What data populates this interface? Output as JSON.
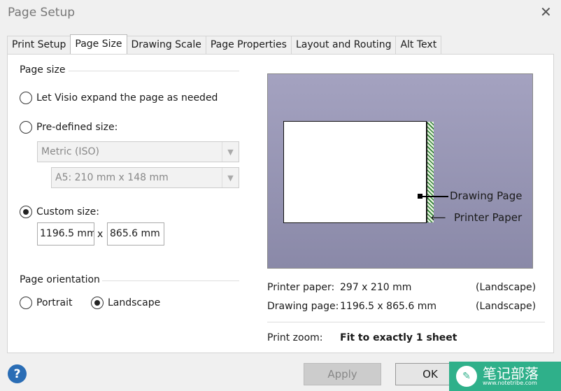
{
  "window": {
    "title": "Page Setup"
  },
  "tabs": [
    {
      "label": "Print Setup"
    },
    {
      "label": "Page Size"
    },
    {
      "label": "Drawing Scale"
    },
    {
      "label": "Page Properties"
    },
    {
      "label": "Layout and Routing"
    },
    {
      "label": "Alt Text"
    }
  ],
  "active_tab": "Page Size",
  "page_size": {
    "heading": "Page size",
    "option_expand": "Let Visio expand the page as needed",
    "option_predefined": "Pre-defined size:",
    "predefined_category": "Metric (ISO)",
    "predefined_size": "A5:  210 mm x 148 mm",
    "option_custom": "Custom size:",
    "selected": "custom",
    "custom_width": "1196.5 mm",
    "times": "x",
    "custom_height": "865.6 mm"
  },
  "orientation": {
    "heading": "Page orientation",
    "portrait": "Portrait",
    "landscape": "Landscape",
    "selected": "landscape"
  },
  "preview": {
    "drawing_page_label": "Drawing Page",
    "printer_paper_label": "Printer Paper"
  },
  "info": {
    "printer_paper_label": "Printer paper:",
    "printer_paper_value": "297 x 210 mm",
    "printer_paper_orient": "(Landscape)",
    "drawing_page_label": "Drawing page:",
    "drawing_page_value": "1196.5 x 865.6 mm",
    "drawing_page_orient": "(Landscape)",
    "print_zoom_label": "Print zoom:",
    "print_zoom_value": "Fit to exactly 1 sheet"
  },
  "buttons": {
    "help": "?",
    "apply": "Apply",
    "ok": "OK"
  },
  "watermark": {
    "text": "笔记部落",
    "url": "www.notetribe.com"
  }
}
